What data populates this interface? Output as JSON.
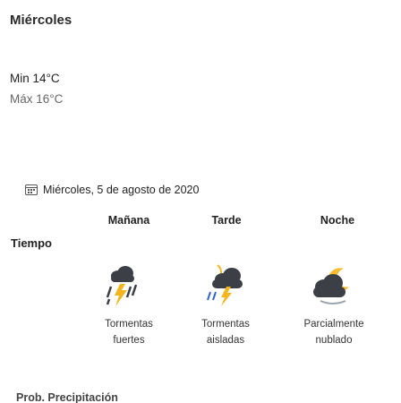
{
  "day": {
    "title": "Miércoles",
    "min": "Min 14°C",
    "max": "Máx 16°C"
  },
  "forecast": {
    "date": "Miércoles, 5 de agosto de 2020",
    "row_label": "Tiempo",
    "periods": [
      {
        "label": "Mañana",
        "condition_line1": "Tormentas",
        "condition_line2": "fuertes",
        "icon": "thunderstorm-heavy-icon"
      },
      {
        "label": "Tarde",
        "condition_line1": "Tormentas",
        "condition_line2": "aisladas",
        "icon": "thunderstorm-isolated-icon"
      },
      {
        "label": "Noche",
        "condition_line1": "Parcialmente",
        "condition_line2": "nublado",
        "icon": "partly-cloudy-night-icon"
      }
    ]
  },
  "footer": {
    "partial_heading": "Prob. Precipitación"
  },
  "colors": {
    "cloud_dark": "#3c3f45",
    "lightning": "#f3b61f",
    "rain": "#2f66c7"
  }
}
